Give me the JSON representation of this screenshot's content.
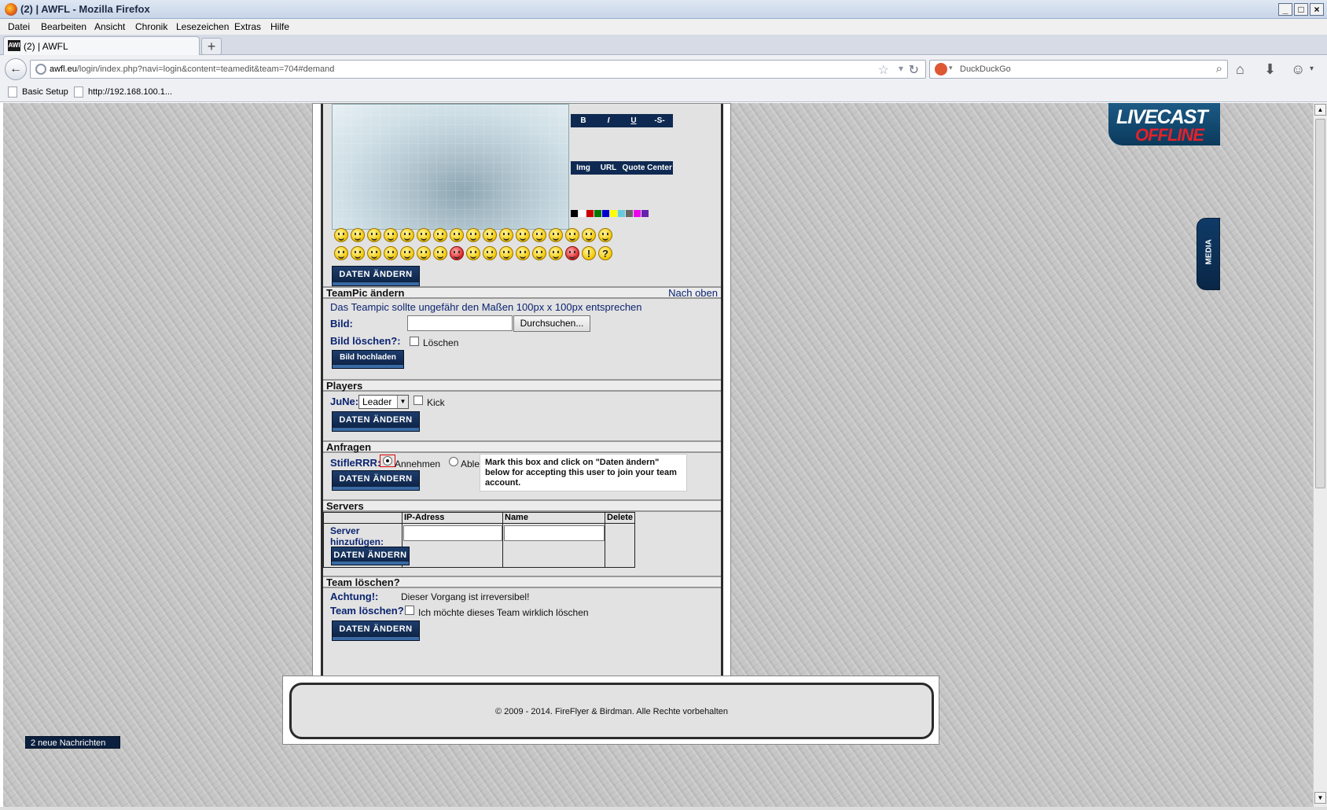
{
  "window": {
    "title": "(2) | AWFL - Mozilla Firefox",
    "buttons": {
      "minimize": "_",
      "maximize": "□",
      "close": "×"
    }
  },
  "menu": [
    "Datei",
    "Bearbeiten",
    "Ansicht",
    "Chronik",
    "Lesezeichen",
    "Extras",
    "Hilfe"
  ],
  "tab": {
    "favicon": "AWI",
    "label": "(2) | AWFL",
    "new_tab": "+"
  },
  "nav": {
    "url_host": "awfl.eu",
    "url_path": "/login/index.php?navi=login&content=teamedit&team=704#demand",
    "search_placeholder": "DuckDuckGo"
  },
  "bookmarks": [
    "Basic Setup",
    "http://192.168.100.1..."
  ],
  "editor": {
    "format_buttons": [
      "B",
      "I",
      "U",
      "-S-"
    ],
    "insert_buttons": [
      "Img",
      "URL",
      "Quote",
      "Center"
    ],
    "colors": [
      "#000000",
      "#ffffff",
      "#cc0000",
      "#007700",
      "#0000cc",
      "#ffff00",
      "#66ccdd",
      "#666666",
      "#ee00ee",
      "#6622aa"
    ],
    "smiley_row1_count": 17,
    "smiley_row2_count": 17,
    "save_label": "DATEN ÄNDERN"
  },
  "teampic": {
    "heading": "TeamPic ändern",
    "top_link": "Nach oben",
    "hint": "Das Teampic sollte ungefähr den Maßen 100px x 100px entsprechen",
    "bild_label": "Bild:",
    "browse_label": "Durchsuchen...",
    "delete_label": "Bild löschen?:",
    "delete_option": "Löschen",
    "upload_label": "Bild hochladen"
  },
  "players": {
    "heading": "Players",
    "player_name": "JuNe:",
    "role_selected": "Leader",
    "kick_label": "Kick",
    "save_label": "DATEN ÄNDERN"
  },
  "anfragen": {
    "heading": "Anfragen",
    "requester": "StifleRRR:",
    "accept_label": "Annehmen",
    "reject_label": "Ablehnen",
    "save_label": "DATEN ÄNDERN",
    "tooltip": "Mark this box and click on \"Daten ändern\" below for accepting this user to join your team account."
  },
  "servers": {
    "heading": "Servers",
    "col_ip": "IP-Adress",
    "col_name": "Name",
    "col_delete": "Delete",
    "add_label_1": "Server",
    "add_label_2": "hinzufügen:",
    "save_label": "DATEN ÄNDERN"
  },
  "delete_team": {
    "heading": "Team löschen?",
    "warning_label": "Achtung!:",
    "warning_text": "Dieser Vorgang ist irreversibel!",
    "confirm_label": "Team löschen?:",
    "confirm_text": "Ich möchte dieses Team wirklich löschen",
    "save_label": "DATEN ÄNDERN"
  },
  "footer": {
    "copyright": "© 2009 - 2014. FireFlyer & Birdman. Alle Rechte vorbehalten"
  },
  "widgets": {
    "livecast_title": "LIVECAST",
    "livecast_status": "OFFLINE",
    "media_label": "MEDIA",
    "messages": "2 neue Nachrichten"
  }
}
